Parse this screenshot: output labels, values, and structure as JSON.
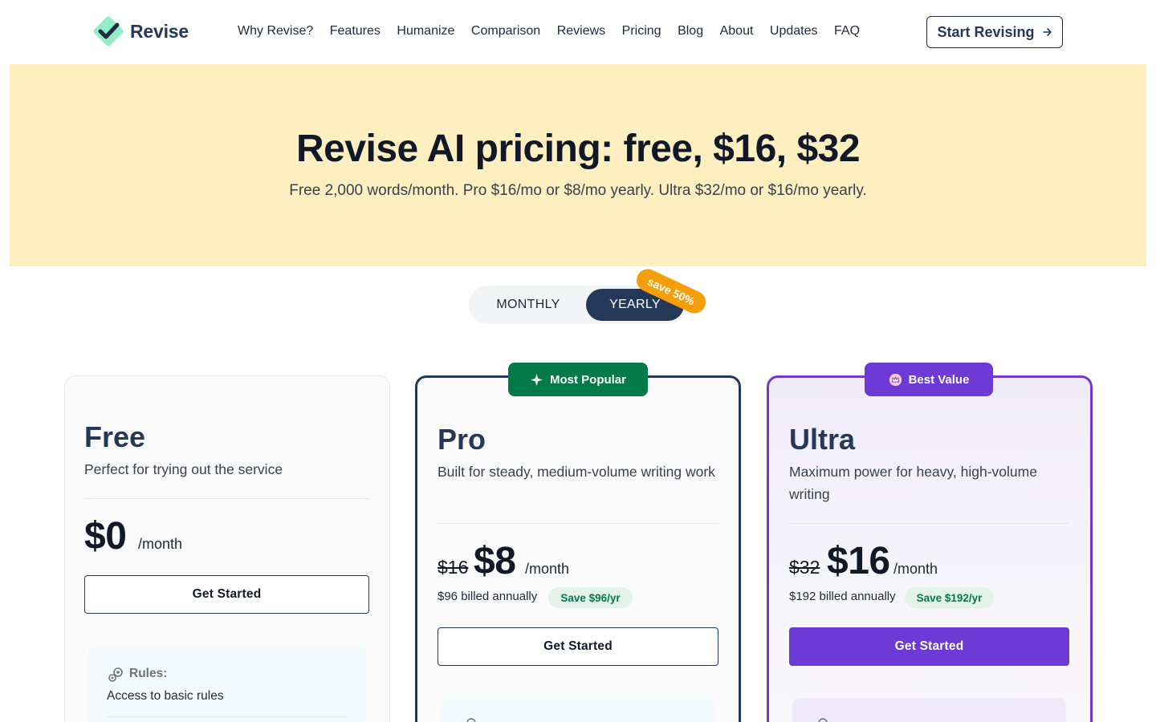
{
  "brand": {
    "name": "Revise",
    "accent": "#253858",
    "logo_colors": [
      "#1f2a44",
      "#3ddc97"
    ]
  },
  "nav": {
    "links": [
      "Why Revise?",
      "Features",
      "Humanize",
      "Comparison",
      "Reviews",
      "Pricing",
      "Blog",
      "About",
      "Updates",
      "FAQ"
    ],
    "cta_label": "Start Revising",
    "cta_icon": "arrow-right-icon"
  },
  "hero": {
    "title": "Revise AI pricing: free, $16, $32",
    "subtitle": "Free 2,000 words/month. Pro $16/mo or $8/mo yearly. Ultra $32/mo or $16/mo yearly.",
    "background": "#fdefc0"
  },
  "billing_toggle": {
    "monthly_label": "MONTHLY",
    "yearly_label": "YEARLY",
    "selected": "YEARLY",
    "save_label": "save 50%",
    "save_color": "#f59e0b"
  },
  "plans": [
    {
      "name": "Free",
      "description": "Perfect for trying out the service",
      "price": "$0",
      "per": "/month",
      "button_label": "Get Started",
      "features": {
        "icon": "rules-icon",
        "label": "Rules:",
        "text": "Access to basic rules"
      }
    },
    {
      "name": "Pro",
      "badge": "Most Popular",
      "badge_icon": "sparkle-icon",
      "badge_color": "#047a48",
      "description": "Built for steady, medium-volume writing work",
      "old_price": "$16",
      "price": "$8",
      "per": "/month",
      "billed": "$96 billed annually",
      "save": "Save $96/yr",
      "button_label": "Get Started"
    },
    {
      "name": "Ultra",
      "badge": "Best Value",
      "badge_icon": "crown-icon",
      "badge_color": "#6d3ad6",
      "description": "Maximum power for heavy, high-volume writing",
      "old_price": "$32",
      "price": "$16",
      "per": "/month",
      "billed": "$192 billed annually",
      "save": "Save $192/yr",
      "button_label": "Get Started"
    }
  ]
}
